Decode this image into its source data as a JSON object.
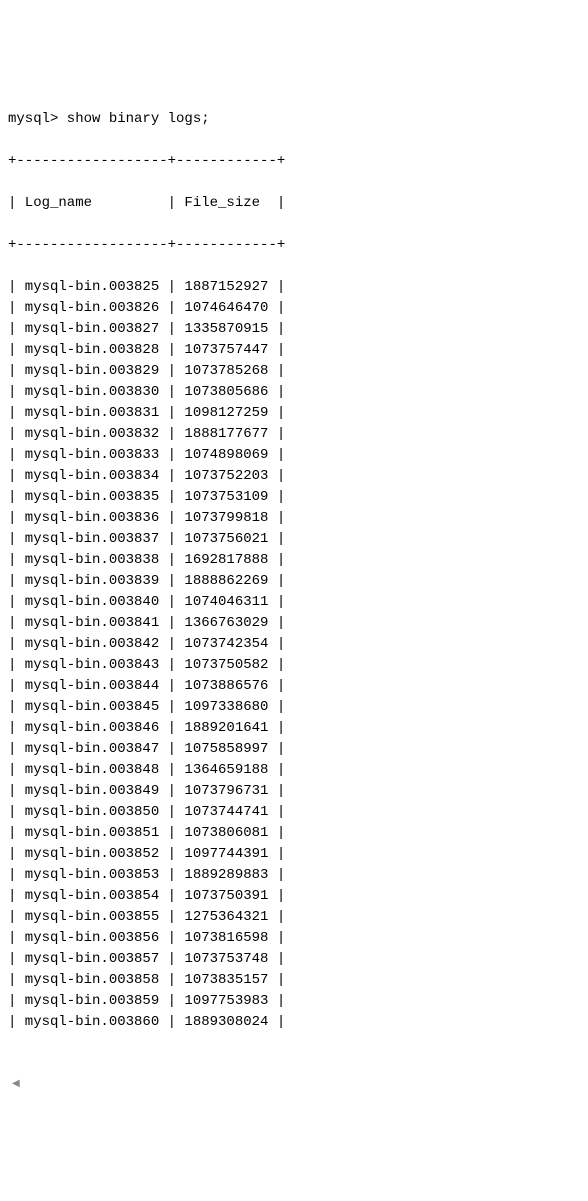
{
  "prompt": "mysql> show binary logs;",
  "divider": "+------------------+------------+",
  "header": "| Log_name         | File_size  |",
  "chart_data": {
    "type": "table",
    "title": "show binary logs",
    "columns": [
      "Log_name",
      "File_size"
    ],
    "rows": [
      {
        "log_name": "mysql-bin.003825",
        "file_size": "1887152927"
      },
      {
        "log_name": "mysql-bin.003826",
        "file_size": "1074646470"
      },
      {
        "log_name": "mysql-bin.003827",
        "file_size": "1335870915"
      },
      {
        "log_name": "mysql-bin.003828",
        "file_size": "1073757447"
      },
      {
        "log_name": "mysql-bin.003829",
        "file_size": "1073785268"
      },
      {
        "log_name": "mysql-bin.003830",
        "file_size": "1073805686"
      },
      {
        "log_name": "mysql-bin.003831",
        "file_size": "1098127259"
      },
      {
        "log_name": "mysql-bin.003832",
        "file_size": "1888177677"
      },
      {
        "log_name": "mysql-bin.003833",
        "file_size": "1074898069"
      },
      {
        "log_name": "mysql-bin.003834",
        "file_size": "1073752203"
      },
      {
        "log_name": "mysql-bin.003835",
        "file_size": "1073753109"
      },
      {
        "log_name": "mysql-bin.003836",
        "file_size": "1073799818"
      },
      {
        "log_name": "mysql-bin.003837",
        "file_size": "1073756021"
      },
      {
        "log_name": "mysql-bin.003838",
        "file_size": "1692817888"
      },
      {
        "log_name": "mysql-bin.003839",
        "file_size": "1888862269"
      },
      {
        "log_name": "mysql-bin.003840",
        "file_size": "1074046311"
      },
      {
        "log_name": "mysql-bin.003841",
        "file_size": "1366763029"
      },
      {
        "log_name": "mysql-bin.003842",
        "file_size": "1073742354"
      },
      {
        "log_name": "mysql-bin.003843",
        "file_size": "1073750582"
      },
      {
        "log_name": "mysql-bin.003844",
        "file_size": "1073886576"
      },
      {
        "log_name": "mysql-bin.003845",
        "file_size": "1097338680"
      },
      {
        "log_name": "mysql-bin.003846",
        "file_size": "1889201641"
      },
      {
        "log_name": "mysql-bin.003847",
        "file_size": "1075858997"
      },
      {
        "log_name": "mysql-bin.003848",
        "file_size": "1364659188"
      },
      {
        "log_name": "mysql-bin.003849",
        "file_size": "1073796731"
      },
      {
        "log_name": "mysql-bin.003850",
        "file_size": "1073744741"
      },
      {
        "log_name": "mysql-bin.003851",
        "file_size": "1073806081"
      },
      {
        "log_name": "mysql-bin.003852",
        "file_size": "1097744391"
      },
      {
        "log_name": "mysql-bin.003853",
        "file_size": "1889289883"
      },
      {
        "log_name": "mysql-bin.003854",
        "file_size": "1073750391"
      },
      {
        "log_name": "mysql-bin.003855",
        "file_size": "1275364321"
      },
      {
        "log_name": "mysql-bin.003856",
        "file_size": "1073816598"
      },
      {
        "log_name": "mysql-bin.003857",
        "file_size": "1073753748"
      },
      {
        "log_name": "mysql-bin.003858",
        "file_size": "1073835157"
      },
      {
        "log_name": "mysql-bin.003859",
        "file_size": "1097753983"
      },
      {
        "log_name": "mysql-bin.003860",
        "file_size": "1889308024"
      }
    ]
  },
  "scroll_indicator": "◀"
}
